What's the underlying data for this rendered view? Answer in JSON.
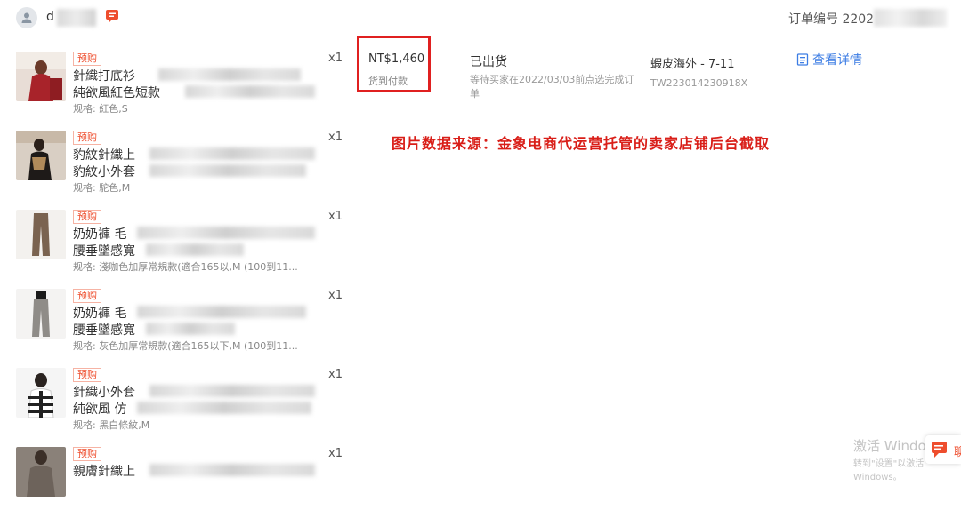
{
  "header": {
    "username": "d",
    "order_label": "订单编号 2202"
  },
  "products": [
    {
      "tag": "预购",
      "name1": "針織打底衫",
      "name2": "純欲風紅色短款",
      "spec": "规格: 紅色,S",
      "qty": "x1"
    },
    {
      "tag": "预购",
      "name1": "豹紋針織上",
      "name2": "豹紋小外套",
      "spec": "规格: 駝色,M",
      "qty": "x1"
    },
    {
      "tag": "预购",
      "name1": "奶奶褲 毛",
      "name2": "腰垂墜感寬",
      "spec": "规格: 淺咖色加厚常規款(適合165以,M (100到11...",
      "qty": "x1"
    },
    {
      "tag": "预购",
      "name1": "奶奶褲 毛",
      "name2": "腰垂墜感寬",
      "spec": "规格: 灰色加厚常規款(適合165以下,M (100到11...",
      "qty": "x1"
    },
    {
      "tag": "预购",
      "name1": "針織小外套",
      "name2": "純欲風 仿",
      "spec": "规格: 黑白條紋,M",
      "qty": "x1"
    },
    {
      "tag": "预购",
      "name1": "親膚針織上",
      "name2": "",
      "spec": "",
      "qty": "x1"
    }
  ],
  "order": {
    "price": "NT$1,460",
    "payment": "货到付款",
    "status": "已出货",
    "status_note": "等待买家在2022/03/03前点选完成订单",
    "carrier": "蝦皮海外 - 7-11",
    "tracking": "TW223014230918X",
    "details_label": "查看详情"
  },
  "watermark": "图片数据来源：金象电商代运营托管的卖家店铺后台截取",
  "windows_activation": {
    "line1": "激活 Windows",
    "line2": "转到\"设置\"以激活 Windows。"
  },
  "float_chat_label": "聊",
  "colors": {
    "accent_orange": "#ee4d2d",
    "link_blue": "#3d7de4",
    "highlight_red": "#e02020"
  }
}
